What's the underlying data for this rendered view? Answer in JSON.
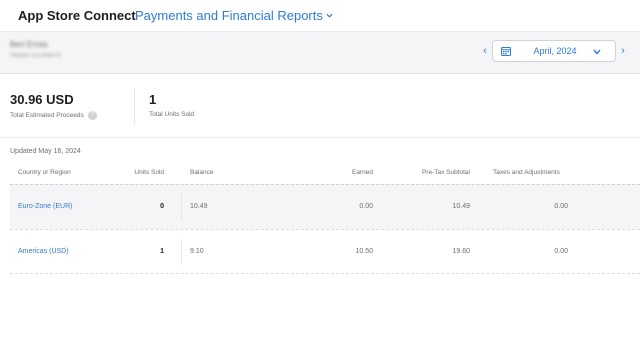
{
  "header": {
    "app_title": "App Store Connect",
    "section": "Payments and Financial Reports"
  },
  "account": {
    "name": "Bert Ernas",
    "subtitle": "Vendor #12345678"
  },
  "period": {
    "value": "April, 2024",
    "icon": "calendar-icon"
  },
  "summary": {
    "proceeds_value": "30.96 USD",
    "proceeds_label": "Total Estimated Proceeds",
    "units_value": "1",
    "units_label": "Total Units Sold"
  },
  "updated": "Updated May 16, 2024",
  "table": {
    "columns": [
      "Country or Region",
      "Units Sold",
      "Balance",
      "Earned",
      "Pre-Tax Subtotal",
      "Taxes and Adjustments"
    ],
    "rows": [
      {
        "region": "Euro-Zone (EUR)",
        "units": "0",
        "balance": "10.49",
        "earned": "0.00",
        "pretax": "10.49",
        "taxes": "0.00"
      },
      {
        "region": "Americas (USD)",
        "units": "1",
        "balance": "9.10",
        "earned": "10.50",
        "pretax": "19.60",
        "taxes": "0.00"
      }
    ]
  },
  "colors": {
    "accent": "#2e7bd6",
    "subheader_bg": "#f5f5f7"
  }
}
